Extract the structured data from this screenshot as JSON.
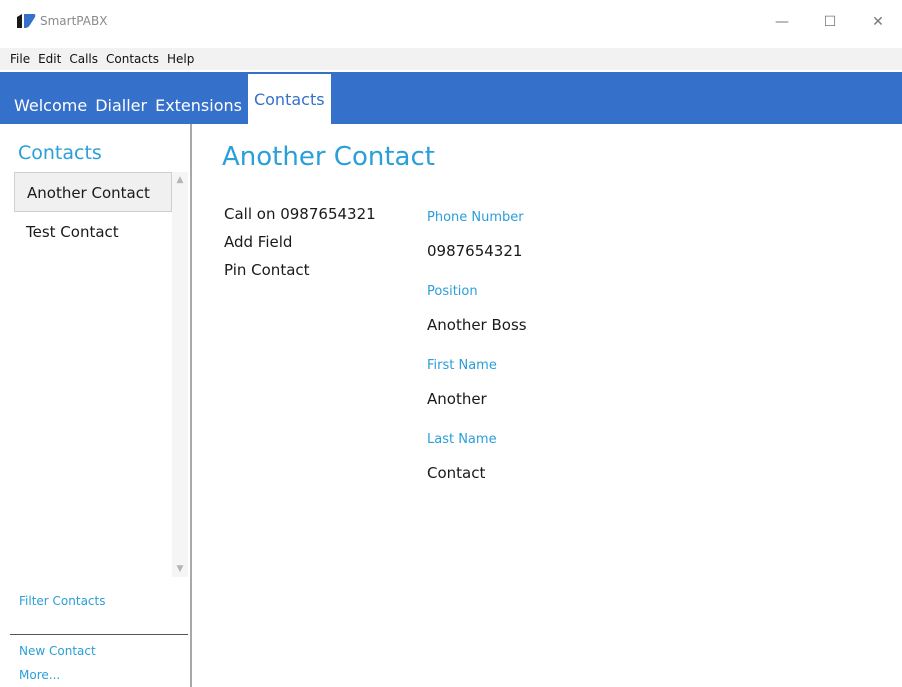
{
  "window": {
    "title": "SmartPABX",
    "controls": {
      "minimize": "—",
      "maximize": "☐",
      "close": "✕"
    }
  },
  "menu": {
    "items": [
      "File",
      "Edit",
      "Calls",
      "Contacts",
      "Help"
    ]
  },
  "tabs": [
    "Welcome",
    "Dialler",
    "Extensions",
    "Contacts"
  ],
  "active_tab": "Contacts",
  "sidebar": {
    "title": "Contacts",
    "contacts": [
      "Another Contact",
      "Test Contact"
    ],
    "selected": "Another Contact",
    "filter_label": "Filter Contacts",
    "new_label": "New Contact",
    "more_label": "More..."
  },
  "detail": {
    "title": "Another Contact",
    "actions": [
      "Call on 0987654321",
      "Add Field",
      "Pin Contact"
    ],
    "fields": [
      {
        "label": "Phone Number",
        "value": "0987654321"
      },
      {
        "label": "Position",
        "value": "Another Boss"
      },
      {
        "label": "First Name",
        "value": "Another"
      },
      {
        "label": "Last Name",
        "value": "Contact"
      }
    ]
  },
  "colors": {
    "accent": "#2a9fd8",
    "tabbar": "#3570ca"
  }
}
